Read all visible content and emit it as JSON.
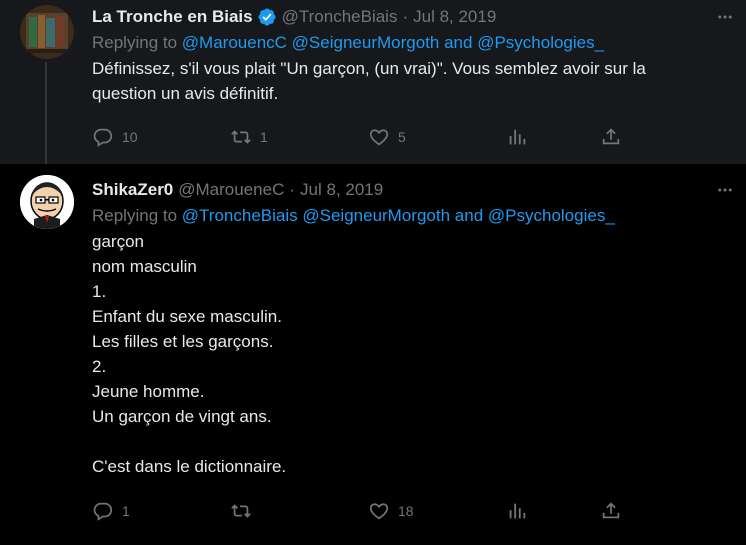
{
  "tweets": [
    {
      "name": "La Tronche en Biais",
      "handle": "@TroncheBiais",
      "sep": "·",
      "date": "Jul 8, 2019",
      "replying_prefix": "Replying to",
      "mention1": "@MarouencC",
      "mention2": "@SeigneurMorgoth",
      "and": "and",
      "mention3": "@Psychologies_",
      "lines": [
        "Définissez, s'il vous plait \"Un garçon, (un vrai)\". Vous semblez avoir sur la",
        "question un avis définitif."
      ],
      "replies": "10",
      "retweets": "1",
      "likes": "5"
    },
    {
      "name": "ShikaZer0",
      "handle": "@MaroueneC",
      "sep": "·",
      "date": "Jul 8, 2019",
      "replying_prefix": "Replying to",
      "mention1": "@TroncheBiais",
      "mention2": "@SeigneurMorgoth",
      "and": "and",
      "mention3": "@Psychologies_",
      "lines": [
        "garçon",
        "nom masculin",
        "1.",
        "Enfant du sexe masculin.",
        "Les filles et les garçons.",
        "2.",
        "Jeune homme.",
        "Un garçon de vingt ans.",
        "",
        "C'est dans le dictionnaire."
      ],
      "replies": "1",
      "retweets": "",
      "likes": "18"
    }
  ],
  "icons": {
    "reply": "reply-icon",
    "retweet": "retweet-icon",
    "like": "heart-icon",
    "views": "views-icon",
    "share": "share-icon",
    "more": "more-icon",
    "verified": "verified-badge-icon"
  },
  "colors": {
    "background": "#000000",
    "highlight_background": "#16181c",
    "text": "#e7e9ea",
    "muted": "#71767b",
    "link": "#1d9bf0"
  }
}
